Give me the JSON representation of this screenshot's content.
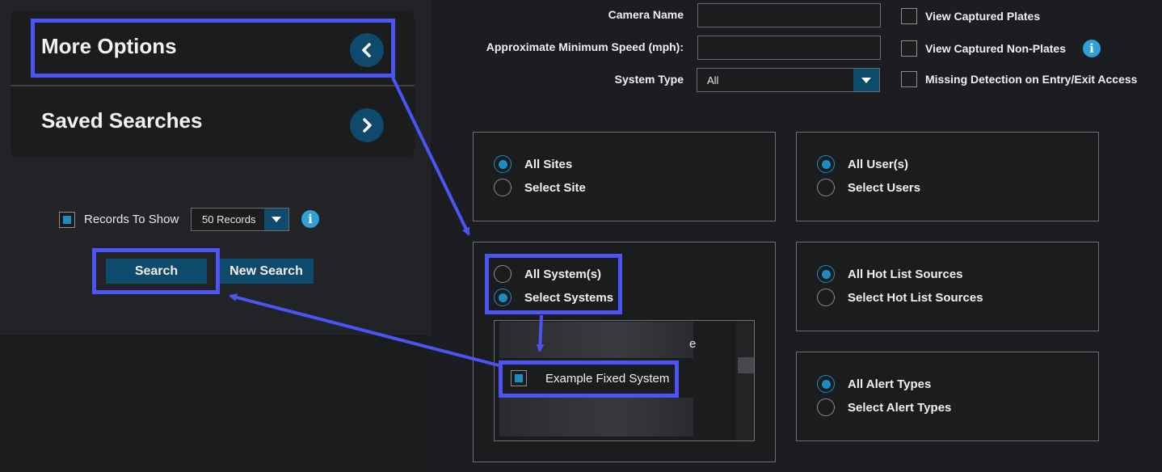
{
  "sidebar": {
    "more_options": "More Options",
    "saved_searches": "Saved Searches",
    "records_to_show_label": "Records To Show",
    "records_select_value": "50 Records",
    "search_button": "Search",
    "new_search_button": "New Search"
  },
  "filters": {
    "camera_name_label": "Camera Name",
    "camera_name_value": "",
    "min_speed_label": "Approximate Minimum Speed (mph):",
    "min_speed_value": "",
    "system_type_label": "System Type",
    "system_type_value": "All",
    "view_captured_plates": "View Captured Plates",
    "view_captured_non_plates": "View Captured Non-Plates",
    "missing_detection": "Missing Detection on Entry/Exit Access"
  },
  "sites": {
    "all": "All Sites",
    "select": "Select Site"
  },
  "users": {
    "all": "All User(s)",
    "select": "Select Users"
  },
  "systems": {
    "all": "All System(s)",
    "select": "Select Systems",
    "partial_text": "e",
    "item": "Example Fixed System"
  },
  "hotlist": {
    "all": "All Hot List Sources",
    "select": "Select Hot List Sources"
  },
  "alerts": {
    "all": "All Alert Types",
    "select": "Select Alert Types"
  },
  "icons": {
    "info": "i"
  },
  "colors": {
    "accent": "#0e4a6c",
    "radio_on": "#1a8dc4",
    "highlight": "#4b55f5"
  }
}
